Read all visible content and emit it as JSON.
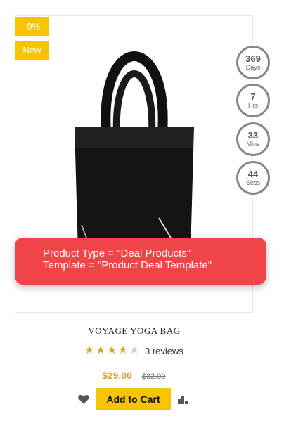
{
  "badges": {
    "discount": "-9%",
    "new": "New"
  },
  "countdown": [
    {
      "value": "369",
      "unit": "Days"
    },
    {
      "value": "7",
      "unit": "Hrs"
    },
    {
      "value": "33",
      "unit": "Mins"
    },
    {
      "value": "44",
      "unit": "Secs"
    }
  ],
  "overlay": {
    "line1": "Product Type  = \"Deal Products\"",
    "line2": "Template = \"Product Deal Template\""
  },
  "product": {
    "title": "VOYAGE YOGA BAG",
    "rating_value": 3.5,
    "rating_max": 5,
    "reviews": "3 reviews",
    "price": "$29.00",
    "old_price": "$32.00"
  },
  "actions": {
    "add_to_cart": "Add to Cart",
    "wishlist_icon": "heart-icon",
    "compare_icon": "bar-chart-icon"
  },
  "colors": {
    "badge": "#f7c400",
    "overlay": "#f04446",
    "price": "#d7a233",
    "star": "#d1a72c"
  }
}
